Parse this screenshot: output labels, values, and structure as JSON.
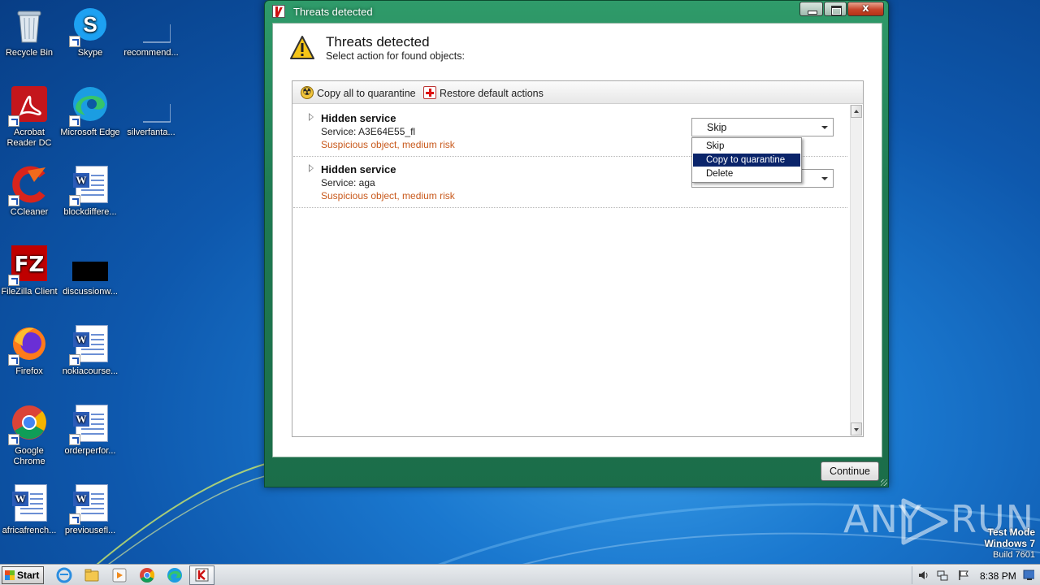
{
  "desktop": {
    "icons": [
      {
        "label": "Recycle Bin",
        "icon": "recycle-bin-icon"
      },
      {
        "label": "Skype",
        "icon": "skype-icon"
      },
      {
        "label": "recommend...",
        "icon": "blank-file-icon"
      },
      {
        "label": "Acrobat Reader DC",
        "icon": "acrobat-icon"
      },
      {
        "label": "Microsoft Edge",
        "icon": "edge-icon"
      },
      {
        "label": "silverfanta...",
        "icon": "blank-file-icon"
      },
      {
        "label": "CCleaner",
        "icon": "ccleaner-icon"
      },
      {
        "label": "blockdiffere...",
        "icon": "word-doc-icon"
      },
      {
        "label": "FileZilla Client",
        "icon": "filezilla-icon"
      },
      {
        "label": "discussionw...",
        "icon": "black-file-icon"
      },
      {
        "label": "Firefox",
        "icon": "firefox-icon"
      },
      {
        "label": "nokiacourse...",
        "icon": "word-doc-icon"
      },
      {
        "label": "Google Chrome",
        "icon": "chrome-icon"
      },
      {
        "label": "orderperfor...",
        "icon": "word-doc-icon"
      },
      {
        "label": "africafrench...",
        "icon": "word-doc-icon"
      },
      {
        "label": "previousefl...",
        "icon": "word-doc-icon"
      }
    ]
  },
  "window": {
    "title": "Threats detected",
    "header_title": "Threats detected",
    "header_subtitle": "Select action for found objects:",
    "toolbar": {
      "copy_all": "Copy all to quarantine",
      "restore": "Restore default actions"
    },
    "threats": [
      {
        "name": "Hidden service",
        "service": "Service: A3E64E55_fl",
        "risk": "Suspicious object, medium risk",
        "action": "Skip"
      },
      {
        "name": "Hidden service",
        "service": "Service: aga",
        "risk": "Suspicious object, medium risk",
        "action": ""
      }
    ],
    "dropdown_options": [
      "Skip",
      "Copy to quarantine",
      "Delete"
    ],
    "dropdown_selected": "Copy to quarantine",
    "continue_label": "Continue",
    "close_glyph": "x"
  },
  "watermark": {
    "brand_left": "ANY",
    "brand_right": "RUN",
    "test_mode": "Test Mode",
    "os": "Windows 7",
    "build": "Build 7601"
  },
  "taskbar": {
    "start_label": "Start",
    "clock": "8:38 PM"
  },
  "colors": {
    "window_frame": "#1f7a52",
    "risk_text": "#c8591c",
    "selection": "#0a246a"
  }
}
